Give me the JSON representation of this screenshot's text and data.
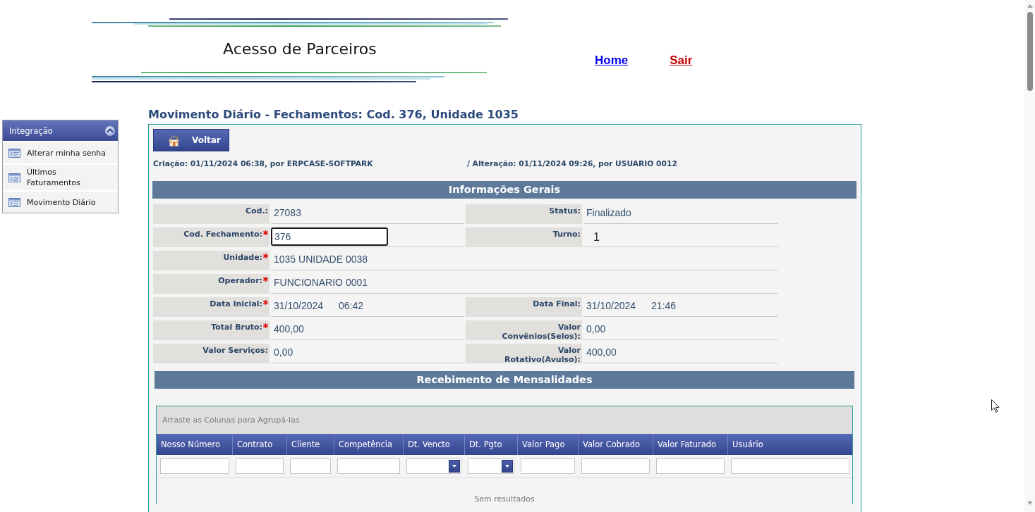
{
  "header": {
    "banner_title": "Acesso de Parceiros",
    "links": [
      {
        "label": "Home",
        "color": "#0000ee"
      },
      {
        "label": "Sair",
        "color": "#c00000"
      }
    ]
  },
  "sidebar": {
    "title": "Integração",
    "expanded": true,
    "items": [
      {
        "label": "Alterar minha senha"
      },
      {
        "label": "Últimos Faturamentos"
      },
      {
        "label": "Movimento Diário"
      }
    ]
  },
  "page": {
    "title": "Movimento Diário - Fechamentos: Cod. 376, Unidade 1035",
    "back_button": "Voltar",
    "created": "Criação: 01/11/2024 06:38, por ERPCASE-SOFTPARK",
    "altered": "/ Alteração: 01/11/2024 09:26, por USUARIO 0012"
  },
  "general_info": {
    "title": "Informações Gerais",
    "rows": [
      {
        "fields": [
          {
            "label": "Cod.:",
            "required": false,
            "kind": "text",
            "value": "27083"
          },
          {
            "label": "Status:",
            "required": false,
            "kind": "text",
            "value": "Finalizado"
          }
        ]
      },
      {
        "fields": [
          {
            "label": "Cod. Fechamento:",
            "required": true,
            "kind": "input",
            "value": "376",
            "focused": true
          },
          {
            "label": "Turno:",
            "required": false,
            "kind": "readonly",
            "value": "1"
          }
        ]
      },
      {
        "fields": [
          {
            "label": "Unidade:",
            "required": true,
            "kind": "text",
            "value": "1035 UNIDADE 0038"
          }
        ]
      },
      {
        "fields": [
          {
            "label": "Operador:",
            "required": true,
            "kind": "text",
            "value": "FUNCIONARIO 0001"
          }
        ]
      },
      {
        "fields": [
          {
            "label": "Data Inicial:",
            "required": true,
            "kind": "datetime",
            "value": "31/10/2024",
            "time": "06:42"
          },
          {
            "label": "Data Final:",
            "required": false,
            "kind": "datetime",
            "value": "31/10/2024",
            "time": "21:46"
          }
        ]
      },
      {
        "fields": [
          {
            "label": "Total Bruto:",
            "required": true,
            "kind": "text",
            "value": "400,00"
          },
          {
            "label": "Valor Convênios(Selos):",
            "required": false,
            "kind": "text",
            "value": "0,00"
          }
        ]
      },
      {
        "fields": [
          {
            "label": "Valor Serviços:",
            "required": false,
            "kind": "text",
            "value": "0,00"
          },
          {
            "label": "Valor Rotativo(Avulso):",
            "required": false,
            "kind": "text",
            "value": "400,00"
          }
        ]
      }
    ]
  },
  "receipts": {
    "title": "Recebimento de Mensalidades",
    "group_hint": "Arraste as Colunas para Agrupá-las",
    "columns": [
      {
        "label": "Nosso Número",
        "kind": "text"
      },
      {
        "label": "Contrato",
        "kind": "text"
      },
      {
        "label": "Cliente",
        "kind": "text"
      },
      {
        "label": "Competência",
        "kind": "text"
      },
      {
        "label": "Dt. Vencto",
        "kind": "dropdown"
      },
      {
        "label": "Dt. Pgto",
        "kind": "dropdown"
      },
      {
        "label": "Valor Pago",
        "kind": "text"
      },
      {
        "label": "Valor Cobrado",
        "kind": "text"
      },
      {
        "label": "Valor Faturado",
        "kind": "text"
      },
      {
        "label": "Usuário",
        "kind": "text"
      }
    ],
    "empty_text": "Sem resultados"
  }
}
